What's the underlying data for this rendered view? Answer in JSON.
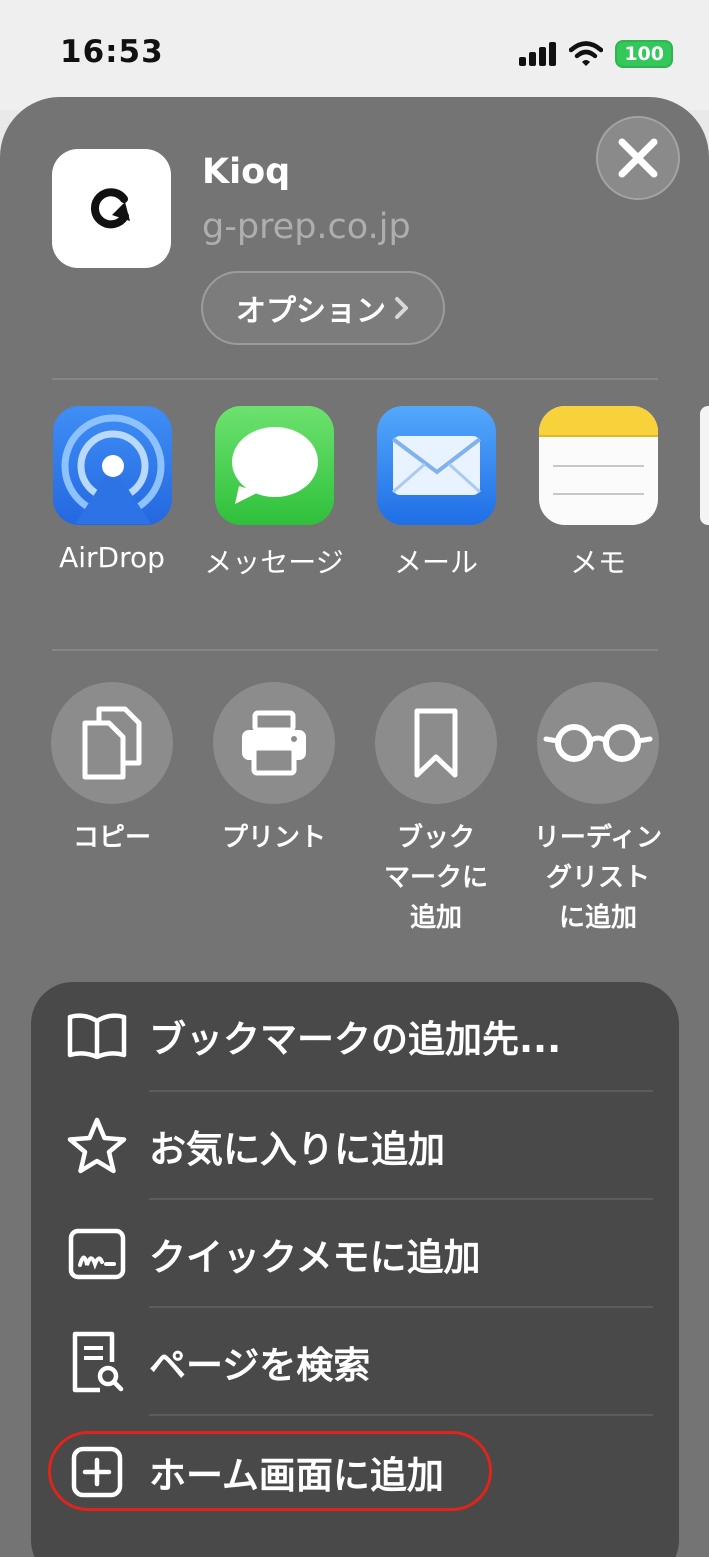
{
  "status_bar": {
    "time": "16:53",
    "battery": "100"
  },
  "share_sheet": {
    "app_name": "Kioq",
    "app_url": "g-prep.co.jp",
    "options_label": "オプション",
    "share_targets": [
      {
        "label": "AirDrop",
        "icon": "airdrop-icon"
      },
      {
        "label": "メッセージ",
        "icon": "messages-icon"
      },
      {
        "label": "メール",
        "icon": "mail-icon"
      },
      {
        "label": "メモ",
        "icon": "notes-icon"
      }
    ],
    "actions": [
      {
        "label": "コピー",
        "icon": "copy-icon"
      },
      {
        "label": "プリント",
        "icon": "print-icon"
      },
      {
        "label": "ブック\nマークに\n追加",
        "icon": "bookmark-icon"
      },
      {
        "label": "リーディン\nグリスト\nに追加",
        "icon": "reading-glasses-icon"
      }
    ],
    "menu": [
      {
        "label": "ブックマークの追加先...",
        "icon": "book-open-icon"
      },
      {
        "label": "お気に入りに追加",
        "icon": "star-icon"
      },
      {
        "label": "クイックメモに追加",
        "icon": "quick-note-icon"
      },
      {
        "label": "ページを検索",
        "icon": "find-page-icon"
      },
      {
        "label": "ホーム画面に追加",
        "icon": "add-square-icon"
      }
    ]
  },
  "colors": {
    "sheet": "#747474",
    "menu": "#494949",
    "highlight": "#e0241b",
    "battery": "#34c759"
  }
}
